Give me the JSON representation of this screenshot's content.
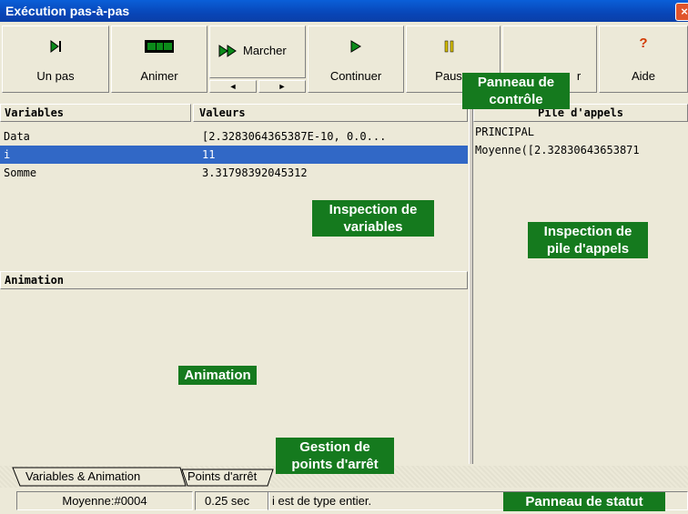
{
  "window": {
    "title": "Exécution pas-à-pas",
    "close_symbol": "×"
  },
  "toolbar": {
    "step": "Un pas",
    "animate": "Animer",
    "walk": "Marcher",
    "walk_left": "◄",
    "walk_right": "►",
    "continue": "Continuer",
    "pause": "Paus",
    "stop_partial": "r",
    "help": "Aide",
    "help_icon_glyph": "?"
  },
  "variables": {
    "header_name": "Variables",
    "header_value": "Valeurs",
    "rows": [
      {
        "name": "Data",
        "value": "[2.3283064365387E-10, 0.0..."
      },
      {
        "name": "i",
        "value": "11"
      },
      {
        "name": "Somme",
        "value": "3.31798392045312"
      }
    ]
  },
  "animation": {
    "header": "Animation"
  },
  "call_stack": {
    "header": "Pile d'appels",
    "items": [
      "PRINCIPAL",
      "Moyenne([2.32830643653871"
    ]
  },
  "tabs": [
    "Variables & Animation",
    "Points d'arrêt"
  ],
  "status": {
    "location": "Moyenne:#0004",
    "time": "0.25 sec",
    "message": "i est de type entier."
  },
  "annotations": {
    "control_panel": "Panneau de contrôle",
    "variable_inspection": "Inspection de variables",
    "call_stack_inspection": "Inspection de pile d'appels",
    "animation": "Animation",
    "breakpoints": "Gestion de points d'arrêt",
    "status_panel": "Panneau de statut"
  },
  "colors": {
    "title_bar": "#0a4fc4",
    "selection": "#3168c6",
    "annotation": "#157a1e"
  }
}
